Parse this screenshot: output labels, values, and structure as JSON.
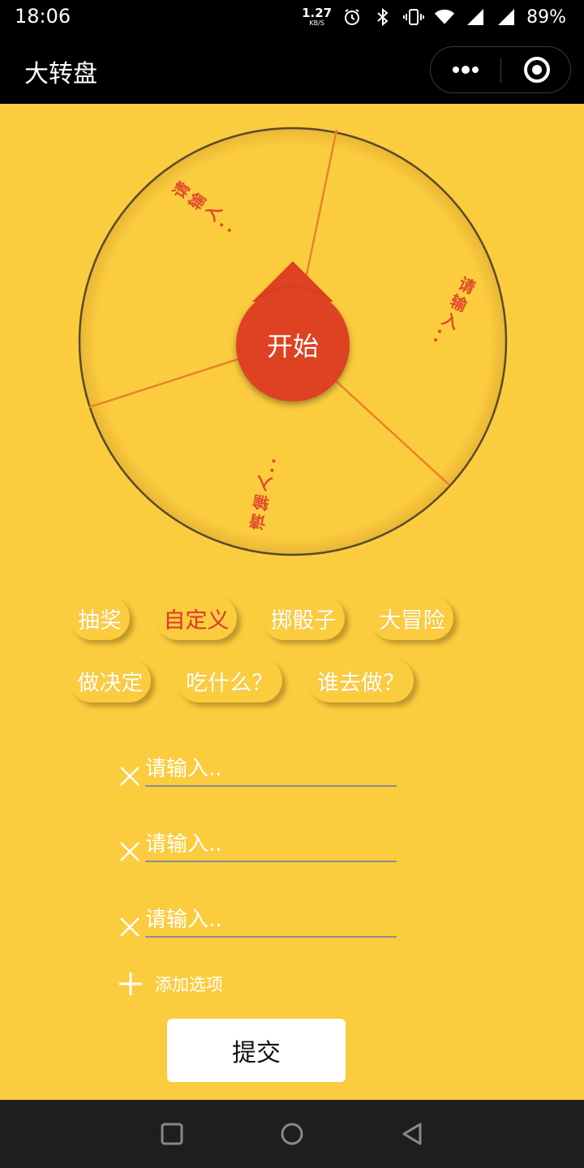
{
  "status_bar": {
    "time": "18:06",
    "net_speed_value": "1.27",
    "net_speed_unit": "KB/S",
    "icons": [
      "alarm-icon",
      "bluetooth-icon",
      "vibrate-icon",
      "wifi-icon",
      "signal-icon",
      "signal-icon"
    ],
    "battery": "89%"
  },
  "title_bar": {
    "title": "大转盘",
    "menu_icon": "more-dots-icon",
    "close_icon": "target-close-icon"
  },
  "wheel": {
    "segment_labels": [
      "请输入..",
      "请输入..",
      "请输入.."
    ],
    "start_label": "开始",
    "colors": {
      "face": "#fccc3f",
      "divider": "#e8832a",
      "label": "#e04a2a",
      "pointer": "#df4123"
    }
  },
  "presets": [
    {
      "label": "抽奖",
      "active": false
    },
    {
      "label": "自定义",
      "active": true
    },
    {
      "label": "掷骰子",
      "active": false
    },
    {
      "label": "大冒险",
      "active": false
    },
    {
      "label": "做决定",
      "active": false
    },
    {
      "label": "吃什么？",
      "active": false
    },
    {
      "label": "谁去做？",
      "active": false
    }
  ],
  "options": [
    {
      "value": "",
      "placeholder": "请输入.."
    },
    {
      "value": "",
      "placeholder": "请输入.."
    },
    {
      "value": "",
      "placeholder": "请输入.."
    }
  ],
  "add_option_label": "添加选项",
  "submit_label": "提交",
  "nav": [
    "recent-apps-icon",
    "home-icon",
    "back-icon"
  ],
  "colors": {
    "background": "#fccc3f",
    "accent": "#df4123",
    "active_text": "#e03a2a"
  }
}
